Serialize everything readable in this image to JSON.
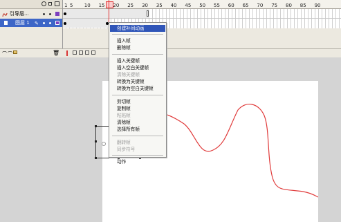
{
  "timeline": {
    "layers": [
      {
        "name": "引导层...",
        "type": "guide"
      },
      {
        "name": "图层 1",
        "type": "normal",
        "selected": true
      }
    ],
    "ruler_ticks": [
      "1",
      "5",
      "10",
      "15",
      "20",
      "25",
      "30",
      "35",
      "40",
      "45",
      "50",
      "55",
      "60",
      "65",
      "70",
      "75",
      "80",
      "85",
      "90"
    ]
  },
  "context_menu": {
    "items": [
      {
        "label": "创建补间动画",
        "state": "highlighted"
      },
      {
        "label": "插入帧",
        "state": "enabled"
      },
      {
        "label": "删除帧",
        "state": "enabled"
      },
      {
        "label": "插入关键帧",
        "state": "enabled"
      },
      {
        "label": "插入空白关键帧",
        "state": "enabled"
      },
      {
        "label": "清除关键帧",
        "state": "disabled"
      },
      {
        "label": "转换为关键帧",
        "state": "enabled"
      },
      {
        "label": "转换为空白关键帧",
        "state": "enabled"
      },
      {
        "label": "剪切帧",
        "state": "enabled"
      },
      {
        "label": "复制帧",
        "state": "enabled"
      },
      {
        "label": "粘贴帧",
        "state": "disabled"
      },
      {
        "label": "清除帧",
        "state": "enabled"
      },
      {
        "label": "选择所有帧",
        "state": "enabled"
      },
      {
        "label": "翻转帧",
        "state": "disabled"
      },
      {
        "label": "同步符号",
        "state": "disabled"
      },
      {
        "label": "动作",
        "state": "enabled"
      }
    ]
  },
  "colors": {
    "selected_layer": "#3d66c7",
    "menu_highlight": "#2f55b8",
    "guide_path": "#e03a3a",
    "playhead": "#e23030",
    "layer_swatch_guide": "#7c3fbf",
    "layer_swatch_layer1": "#7c3fbf"
  },
  "icons": [
    "guide-layer-icon",
    "layer-icon",
    "pencil-icon",
    "eye-icon",
    "lock-icon",
    "outline-icon",
    "trash-icon",
    "add-layer-icon",
    "add-guide-icon",
    "add-folder-icon"
  ]
}
